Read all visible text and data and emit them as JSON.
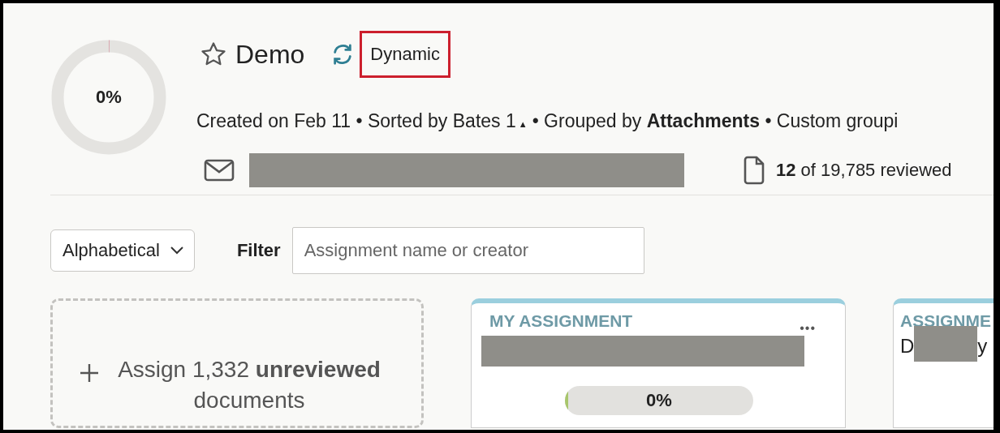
{
  "overview": {
    "progress": {
      "label": "0%",
      "level": 0
    },
    "favorite": false,
    "title": "Demo",
    "mode": {
      "label": "Dynamic",
      "highlighted": true
    },
    "meta": [
      {
        "kind": "text",
        "text": "Created on Feb 11 • Sorted by Bates 1"
      },
      {
        "kind": "arrow",
        "text": "▲"
      },
      {
        "kind": "text",
        "text": "• Grouped by **Attachments** • Custom groupi"
      }
    ],
    "reviewed": "**12** of 19,785 reviewed"
  },
  "controls": {
    "sort": "Alphabetical",
    "filter_label": "Filter",
    "filter": {
      "placeholder": "Assignment name or creator"
    }
  },
  "assign": {
    "text": "Assign 1,332 **unreviewed** documents"
  },
  "cards": [
    {
      "heading": "MY ASSIGNMENT",
      "menu": "•••",
      "progress": {
        "label": "0%",
        "level": 0
      }
    },
    {
      "heading": "ASSIGNME",
      "name_start": "D",
      "name_end": "y"
    }
  ]
}
